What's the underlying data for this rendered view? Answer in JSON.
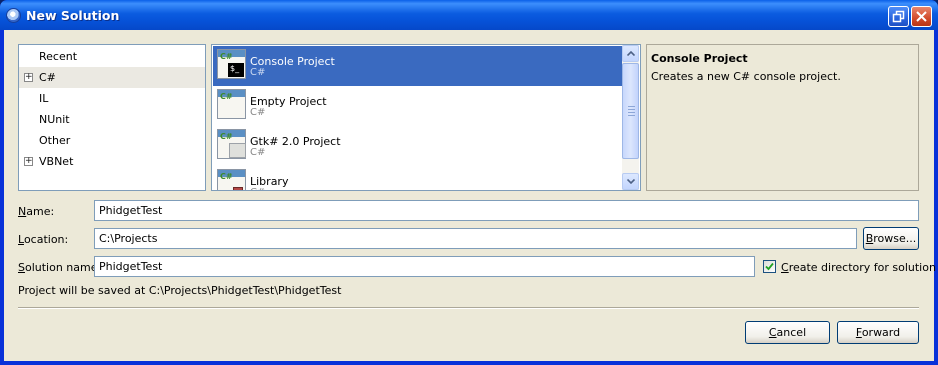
{
  "window": {
    "title": "New Solution"
  },
  "categories": [
    {
      "label": "Recent",
      "expandable": false,
      "selected": false
    },
    {
      "label": "C#",
      "expandable": true,
      "selected": true
    },
    {
      "label": "IL",
      "expandable": false,
      "selected": false
    },
    {
      "label": "NUnit",
      "expandable": false,
      "selected": false
    },
    {
      "label": "Other",
      "expandable": false,
      "selected": false
    },
    {
      "label": "VBNet",
      "expandable": true,
      "selected": false
    }
  ],
  "templates": [
    {
      "name": "Console Project",
      "language": "C#",
      "icon": "console-project-icon",
      "selected": true
    },
    {
      "name": "Empty Project",
      "language": "C#",
      "icon": "empty-project-icon",
      "selected": false
    },
    {
      "name": "Gtk# 2.0 Project",
      "language": "C#",
      "icon": "gtk-project-icon",
      "selected": false
    },
    {
      "name": "Library",
      "language": "C#",
      "icon": "library-icon",
      "selected": false
    }
  ],
  "description": {
    "title": "Console Project",
    "text": "Creates a new C# console project."
  },
  "form": {
    "name_label_accel": "N",
    "name_label_rest": "ame:",
    "name_value": "PhidgetTest",
    "location_label_accel": "L",
    "location_label_rest": "ocation:",
    "location_value": "C:\\Projects",
    "browse_accel": "B",
    "browse_rest": "rowse...",
    "solution_label_accel": "S",
    "solution_label_rest": "olution name:",
    "solution_value": "PhidgetTest",
    "create_dir_accel": "C",
    "create_dir_rest": "reate directory for solution",
    "create_dir_checked": true,
    "save_path_text": "Project will be saved at C:\\Projects\\PhidgetTest\\PhidgetTest"
  },
  "buttons": {
    "cancel_accel": "C",
    "cancel_rest": "ancel",
    "forward_accel": "F",
    "forward_rest": "orward"
  },
  "colors": {
    "selection": "#3a6ac0",
    "titlebar": "#0652d8",
    "dialog_bg": "#ece9d8"
  }
}
